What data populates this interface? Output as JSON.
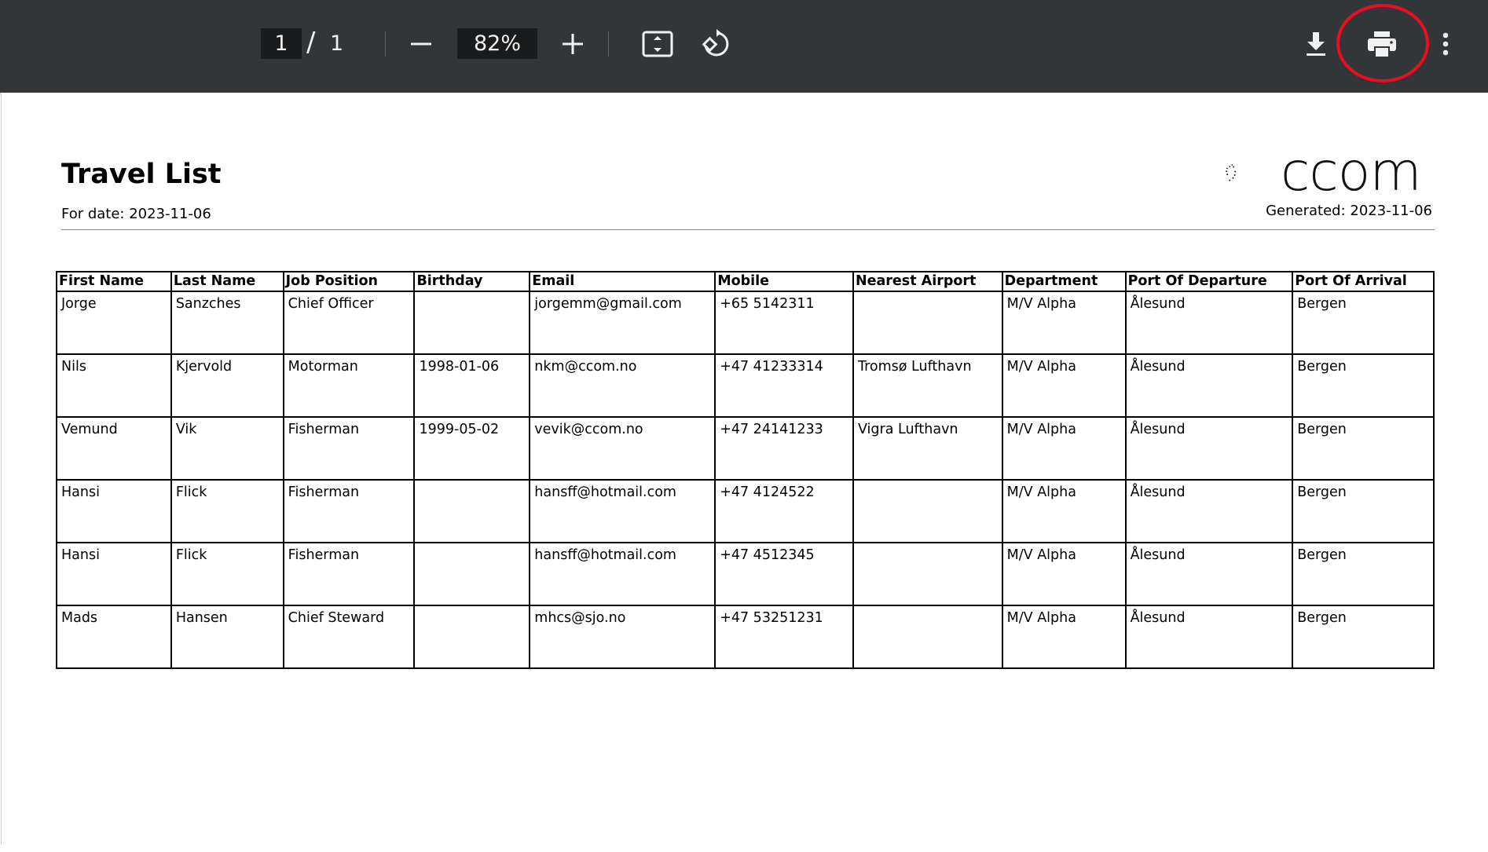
{
  "toolbar": {
    "page_current": "1",
    "page_separator": "/",
    "page_total": "1",
    "zoom": "82%",
    "icons": {
      "zoom_out": "minus-icon",
      "zoom_in": "plus-icon",
      "fit": "fit-to-page-icon",
      "rotate": "rotate-icon",
      "download": "download-icon",
      "print": "print-icon",
      "more": "more-vert-icon"
    },
    "highlight_color": "#e8101c"
  },
  "document": {
    "title": "Travel List",
    "for_date": "For date: 2023-11-06",
    "generated": "Generated: 2023-11-06",
    "logo_text": "ccom",
    "table": {
      "headers": [
        "First Name",
        "Last Name",
        "Job Position",
        "Birthday",
        "Email",
        "Mobile",
        "Nearest Airport",
        "Department",
        "Port Of Departure",
        "Port Of Arrival"
      ],
      "rows": [
        [
          "Jorge",
          "Sanzches",
          "Chief Officer",
          "",
          "jorgemm@gmail.com",
          "+65 5142311",
          "",
          "M/V Alpha",
          "Ålesund",
          "Bergen"
        ],
        [
          "Nils",
          "Kjervold",
          "Motorman",
          "1998-01-06",
          "nkm@ccom.no",
          "+47 41233314",
          "Tromsø Lufthavn",
          "M/V Alpha",
          "Ålesund",
          "Bergen"
        ],
        [
          "Vemund",
          "Vik",
          "Fisherman",
          "1999-05-02",
          "vevik@ccom.no",
          "+47 24141233",
          "Vigra Lufthavn",
          "M/V Alpha",
          "Ålesund",
          "Bergen"
        ],
        [
          "Hansi",
          "Flick",
          "Fisherman",
          "",
          "hansff@hotmail.com",
          "+47 4124522",
          "",
          "M/V Alpha",
          "Ålesund",
          "Bergen"
        ],
        [
          "Hansi",
          "Flick",
          "Fisherman",
          "",
          "hansff@hotmail.com",
          "+47 4512345",
          "",
          "M/V Alpha",
          "Ålesund",
          "Bergen"
        ],
        [
          "Mads",
          "Hansen",
          "Chief Steward",
          "",
          "mhcs@sjo.no",
          "+47 53251231",
          "",
          "M/V Alpha",
          "Ålesund",
          "Bergen"
        ]
      ]
    }
  }
}
